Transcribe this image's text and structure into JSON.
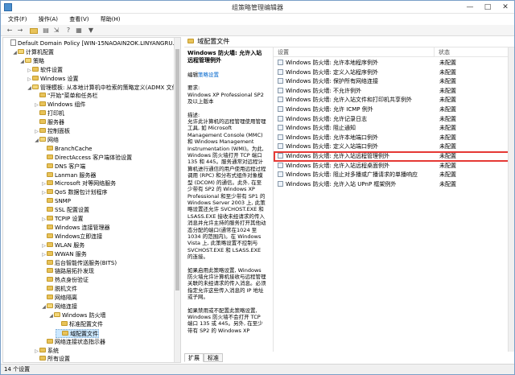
{
  "window": {
    "title": "组策略管理编辑器",
    "controls": [
      "—",
      "□",
      "✕"
    ]
  },
  "menu": [
    "文件(F)",
    "操作(A)",
    "查看(V)",
    "帮助(H)"
  ],
  "toolbar": [
    "back-icon",
    "forward-icon",
    "folder-icon",
    "properties-icon",
    "export-icon",
    "help-icon",
    "view-icon",
    "filter-icon"
  ],
  "tree": {
    "rows": [
      {
        "text": "Default Domain Policy [WIN-15NAOAIN2OK.LINYANGRU.COM]",
        "level": 0,
        "toggle": "",
        "icon": "doc"
      },
      {
        "text": "计算机配置",
        "level": 1,
        "toggle": "◢",
        "icon": "folder-open"
      },
      {
        "text": "策略",
        "level": 2,
        "toggle": "◢",
        "icon": "folder-open"
      },
      {
        "text": "软件设置",
        "level": 3,
        "toggle": "▷",
        "icon": "folder"
      },
      {
        "text": "Windows 设置",
        "level": 3,
        "toggle": "▷",
        "icon": "folder"
      },
      {
        "text": "管理模板: 从本地计算机中检索的策略定义(ADMX 文件)。",
        "level": 3,
        "toggle": "◢",
        "icon": "folder-open"
      },
      {
        "text": "\"开始\"菜单和任务栏",
        "level": 4,
        "toggle": "",
        "icon": "folder"
      },
      {
        "text": "Windows 组件",
        "level": 4,
        "toggle": "▷",
        "icon": "folder"
      },
      {
        "text": "打印机",
        "level": 4,
        "toggle": "",
        "icon": "folder"
      },
      {
        "text": "服务器",
        "level": 4,
        "toggle": "",
        "icon": "folder"
      },
      {
        "text": "控制面板",
        "level": 4,
        "toggle": "▷",
        "icon": "folder"
      },
      {
        "text": "网络",
        "level": 4,
        "toggle": "◢",
        "icon": "folder-open"
      },
      {
        "text": "BranchCache",
        "level": 5,
        "toggle": "",
        "icon": "folder"
      },
      {
        "text": "DirectAccess 客户端体验设置",
        "level": 5,
        "toggle": "",
        "icon": "folder"
      },
      {
        "text": "DNS 客户端",
        "level": 5,
        "toggle": "",
        "icon": "folder"
      },
      {
        "text": "Lanman 服务器",
        "level": 5,
        "toggle": "",
        "icon": "folder"
      },
      {
        "text": "Microsoft 对等网络服务",
        "level": 5,
        "toggle": "▷",
        "icon": "folder"
      },
      {
        "text": "QoS 数据包计划程序",
        "level": 5,
        "toggle": "▷",
        "icon": "folder"
      },
      {
        "text": "SNMP",
        "level": 5,
        "toggle": "",
        "icon": "folder"
      },
      {
        "text": "SSL 配置设置",
        "level": 5,
        "toggle": "",
        "icon": "folder"
      },
      {
        "text": "TCPIP 设置",
        "level": 5,
        "toggle": "▷",
        "icon": "folder"
      },
      {
        "text": "Windows 连接管理器",
        "level": 5,
        "toggle": "",
        "icon": "folder"
      },
      {
        "text": "Windows立即连接",
        "level": 5,
        "toggle": "",
        "icon": "folder"
      },
      {
        "text": "WLAN 服务",
        "level": 5,
        "toggle": "▷",
        "icon": "folder"
      },
      {
        "text": "WWAN 服务",
        "level": 5,
        "toggle": "▷",
        "icon": "folder"
      },
      {
        "text": "后台智能传送服务(BITS)",
        "level": 5,
        "toggle": "",
        "icon": "folder"
      },
      {
        "text": "链路层拓扑发现",
        "level": 5,
        "toggle": "",
        "icon": "folder"
      },
      {
        "text": "热点身份验证",
        "level": 5,
        "toggle": "",
        "icon": "folder"
      },
      {
        "text": "脱机文件",
        "level": 5,
        "toggle": "",
        "icon": "folder"
      },
      {
        "text": "网络隔离",
        "level": 5,
        "toggle": "",
        "icon": "folder"
      },
      {
        "text": "网络连接",
        "level": 5,
        "toggle": "◢",
        "icon": "folder-open"
      },
      {
        "text": "Windows 防火墙",
        "level": 6,
        "toggle": "◢",
        "icon": "folder-open"
      },
      {
        "text": "标准配置文件",
        "level": 7,
        "toggle": "",
        "icon": "folder"
      },
      {
        "text": "域配置文件",
        "level": 7,
        "toggle": "",
        "icon": "folder",
        "selected": true
      },
      {
        "text": "网络连接状态指示器",
        "level": 5,
        "toggle": "",
        "icon": "folder"
      },
      {
        "text": "系统",
        "level": 4,
        "toggle": "▷",
        "icon": "folder"
      },
      {
        "text": "所有设置",
        "level": 4,
        "toggle": "",
        "icon": "folder"
      }
    ]
  },
  "right_header": {
    "title": "域配置文件"
  },
  "description": {
    "heading": "Windows 防火墙: 允许入站远程管理例外",
    "edit_prefix": "编辑",
    "edit_link": "策略设置",
    "req_label": "要求:",
    "req_text": "Windows XP Professional SP2 及以上版本",
    "desc_label": "描述:",
    "desc_text": "允许此计算机的远程管理使用管理工具, 如 Microsoft Management Console (MMC) 和 Windows Management Instrumentation (WMI)。为此, Windows 防火墙打开 TCP 端口 135 和 445。服务通常对远程计算机进行通信的用户使用远程过程调用 (RPC) 和分布式组件对象模型 (DCOM) 的通信。此外, 在至少带有 SP2 的 Windows XP Professional 和至少带有 SP1 的 Windows Server 2003 上, 此策略设置还允许 SVCHOST.EXE 和 LSASS.EXE 接收未经请求的传入消息并允许主持的服务打开其他动态分配的端口(通常在1024 至 1034 的范围内)。在 Windows Vista 上, 此策略设置不控制与 SVCHOST.EXE 和 LSASS.EXE 的连接。",
    "p2": "如果启用此策略设置, Windows 防火墙允许计算机接收与远程管理关联的未经请求的传入消息。必须指定允许这些传入消息的 IP 地址或子网。",
    "p3": "如果禁用或不配置此策略设置, Windows 防火墙不会打开 TCP 端口 135 或 445。另外, 在至少带有 SP2 的 Windows XP"
  },
  "list": {
    "col_setting": "设置",
    "col_state": "状态",
    "rows": [
      {
        "name": "Windows 防火墙: 允许本地程序例外",
        "state": "未配置"
      },
      {
        "name": "Windows 防火墙: 定义入站程序例外",
        "state": "未配置"
      },
      {
        "name": "Windows 防火墙: 保护所有网络连接",
        "state": "未配置"
      },
      {
        "name": "Windows 防火墙: 不允许例外",
        "state": "未配置"
      },
      {
        "name": "Windows 防火墙: 允许入站文件和打印机共享例外",
        "state": "未配置"
      },
      {
        "name": "Windows 防火墙: 允许 ICMP 例外",
        "state": "未配置"
      },
      {
        "name": "Windows 防火墙: 允许记录日志",
        "state": "未配置"
      },
      {
        "name": "Windows 防火墙: 阻止通知",
        "state": "未配置"
      },
      {
        "name": "Windows 防火墙: 允许本地端口例外",
        "state": "未配置"
      },
      {
        "name": "Windows 防火墙: 定义入站端口例外",
        "state": "未配置"
      },
      {
        "name": "Windows 防火墙: 允许入站远程管理例外",
        "state": "未配置",
        "highlighted": true
      },
      {
        "name": "Windows 防火墙: 允许入站远程桌面例外",
        "state": "未配置"
      },
      {
        "name": "Windows 防火墙: 阻止对多播或广播请求的单播响应",
        "state": "未配置"
      },
      {
        "name": "Windows 防火墙: 允许入站 UPnP 框架例外",
        "state": "未配置"
      }
    ]
  },
  "tabs": [
    "扩展",
    "标准"
  ],
  "status": "14 个设置",
  "colors": {
    "highlight": "#e53935",
    "selection": "#cce8ff",
    "link": "#0066cc"
  }
}
